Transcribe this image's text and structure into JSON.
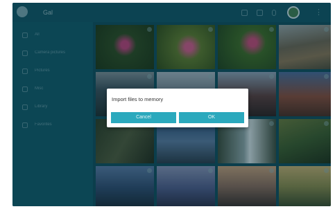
{
  "app": {
    "title": "Gal"
  },
  "topbar": {
    "icons": [
      "search-icon",
      "filter-icon",
      "info-icon",
      "more-icon"
    ],
    "kebab": "⋮"
  },
  "sidebar": {
    "items": [
      {
        "icon": "home-icon",
        "label": "All"
      },
      {
        "icon": "camera-icon",
        "label": "Camera pictures"
      },
      {
        "icon": "folder-icon",
        "label": "Pictures"
      },
      {
        "icon": "folder-icon",
        "label": "Misc"
      },
      {
        "icon": "folder-icon",
        "label": "Library"
      },
      {
        "icon": "folder-icon",
        "label": "Favorites"
      }
    ]
  },
  "dialog": {
    "title": "Import files to memory",
    "cancel_label": "Cancel",
    "ok_label": "OK"
  },
  "colors": {
    "background": "#0e4c5c",
    "sidebar": "#10596a",
    "accent": "#2ba9bd"
  },
  "photos": [
    "flower-photo-1",
    "flower-photo-2",
    "flower-photo-3",
    "landscape-photo-1",
    "landscape-photo-2",
    "landscape-photo-3",
    "landscape-photo-4",
    "landscape-photo-5",
    "landscape-photo-6",
    "landscape-photo-7",
    "landscape-photo-8",
    "landscape-photo-9",
    "landscape-photo-10",
    "landscape-photo-11",
    "landscape-photo-12",
    "landscape-photo-13"
  ]
}
